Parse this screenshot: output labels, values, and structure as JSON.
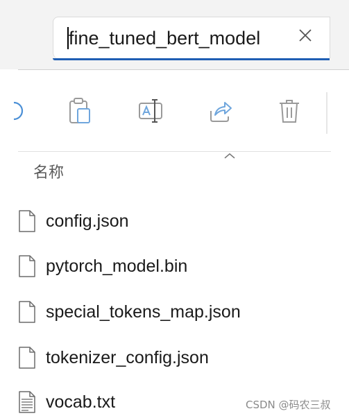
{
  "rename_field": {
    "value": "fine_tuned_bert_model"
  },
  "toolbar": {
    "icons": [
      "cut-icon",
      "paste-icon",
      "rename-icon",
      "share-icon",
      "delete-icon"
    ]
  },
  "file_list": {
    "column_header": "名称",
    "sort_direction": "ascending",
    "files": [
      {
        "name": "config.json",
        "icon": "file-icon"
      },
      {
        "name": "pytorch_model.bin",
        "icon": "file-icon"
      },
      {
        "name": "special_tokens_map.json",
        "icon": "file-icon"
      },
      {
        "name": "tokenizer_config.json",
        "icon": "file-icon"
      },
      {
        "name": "vocab.txt",
        "icon": "text-file-icon"
      }
    ]
  },
  "watermark": "CSDN @码农三叔",
  "colors": {
    "accent": "#1f5eb3",
    "icon_gray": "#9a9a9a",
    "band_background": "#f3f3f3"
  }
}
